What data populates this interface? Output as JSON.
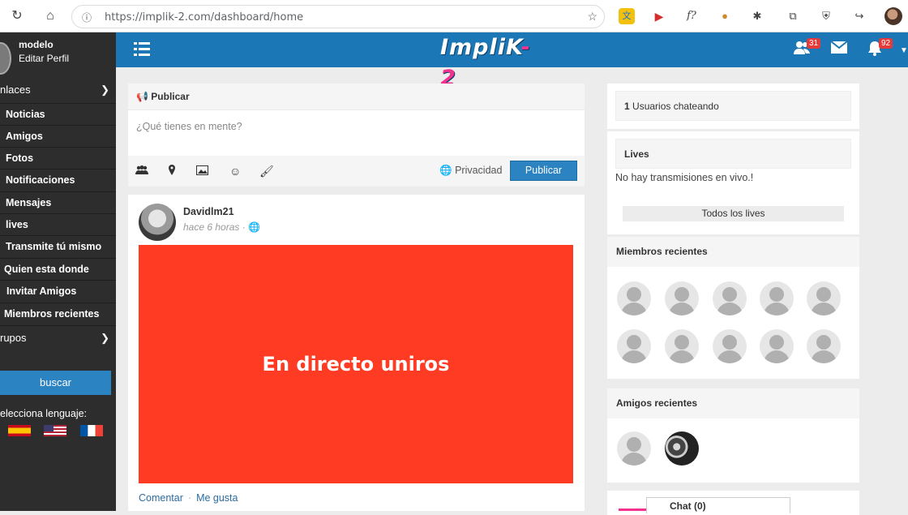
{
  "browser": {
    "url": "https://implik-2.com/dashboard/home"
  },
  "topbar": {
    "logo_main": "ImpliK",
    "logo_accent": "-2",
    "friends_badge": "31",
    "notifications_badge": "92"
  },
  "sidebar": {
    "user_name": "modelo",
    "edit_profile": "Editar Perfil",
    "section_links": "nlaces",
    "items": [
      {
        "label": "Noticias"
      },
      {
        "label": "Amigos"
      },
      {
        "label": "Fotos"
      },
      {
        "label": "Notificaciones"
      },
      {
        "label": "Mensajes"
      },
      {
        "label": "lives"
      },
      {
        "label": "Transmite tú mismo"
      },
      {
        "label": "Quien esta donde"
      },
      {
        "label": "Invitar Amigos"
      },
      {
        "label": "Miembros recientes"
      }
    ],
    "section_groups": "rupos",
    "search_button": "buscar",
    "language_label": "elecciona lenguaje:"
  },
  "composer": {
    "header": "Publicar",
    "placeholder": "¿Qué tienes en mente?",
    "privacy": "Privacidad",
    "publish_button": "Publicar"
  },
  "post": {
    "user": "Davidlm21",
    "time": "hace 6 horas ·",
    "image_text": "En directo uniros",
    "comment": "Comentar",
    "like": "Me gusta"
  },
  "right": {
    "chat_count": "1",
    "chat_text": "Usuarios chateando",
    "lives_header": "Lives",
    "lives_empty": "No hay transmisiones en vivo.!",
    "lives_all": "Todos los lives",
    "members_header": "Miembros recientes",
    "friends_header": "Amigos recientes"
  },
  "chat": {
    "label": "Chat (0)"
  }
}
